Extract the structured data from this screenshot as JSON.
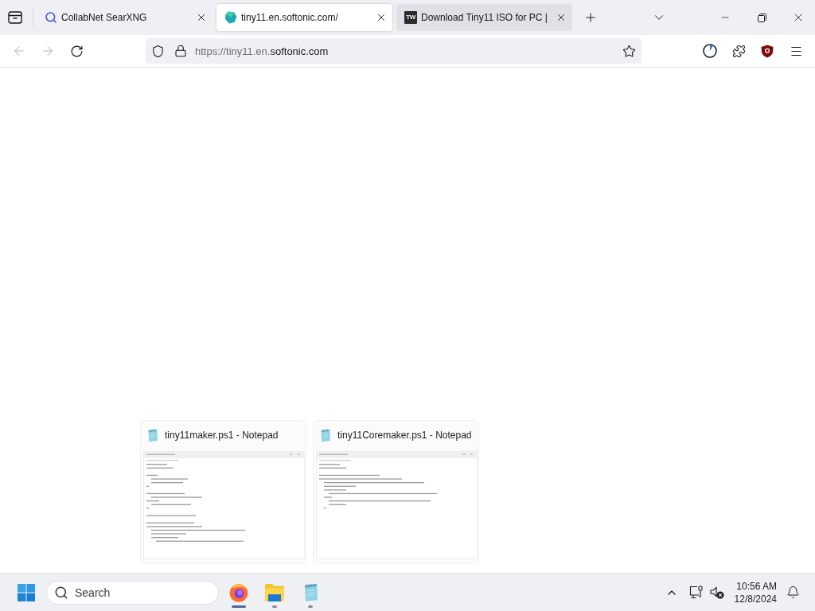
{
  "browser": {
    "tabs": [
      {
        "kind": "search",
        "label": "CollabNet SearXNG",
        "selected": false,
        "hovered": false
      },
      {
        "kind": "gem",
        "label": "tiny11.en.softonic.com/",
        "selected": true,
        "hovered": false
      },
      {
        "kind": "monogram",
        "favicon_text": "TW",
        "label": "Download Tiny11 ISO for PC |",
        "selected": false,
        "hovered": true
      }
    ],
    "toolbar": {
      "back": {
        "disabled": true
      },
      "forward": {
        "disabled": true
      }
    },
    "address_bar": {
      "url_prefix": "https://tiny11.en.",
      "url_domain": "softonic.com"
    }
  },
  "thumbnails": [
    {
      "title": "tiny11maker.ps1 - Notepad"
    },
    {
      "title": "tiny11Coremaker.ps1 - Notepad"
    }
  ],
  "taskbar": {
    "search": {
      "label": "Search"
    },
    "apps": [
      {
        "kind": "browser",
        "active": true
      },
      {
        "kind": "folder",
        "active": false
      },
      {
        "kind": "notepad",
        "active": false
      }
    ],
    "tray": {
      "time": "10:56 AM",
      "date": "12/8/2024"
    }
  }
}
